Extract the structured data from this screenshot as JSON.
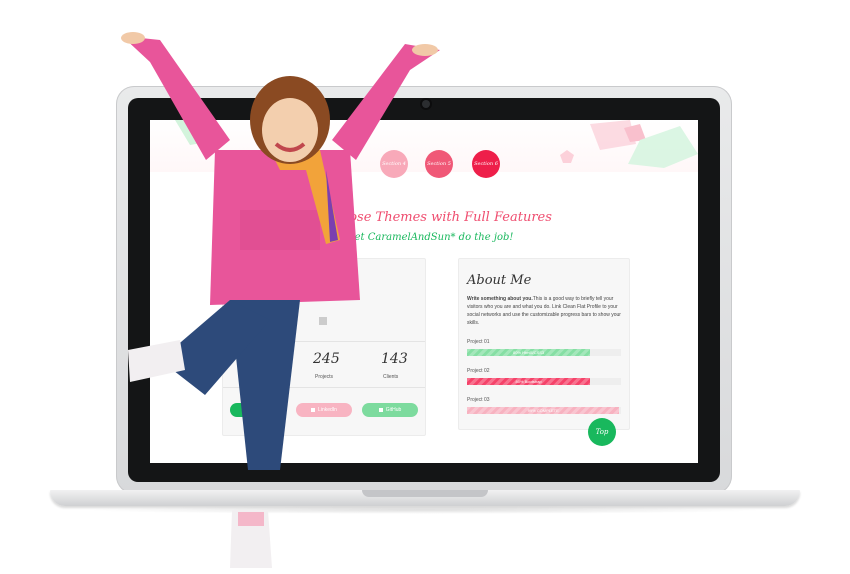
{
  "nav": {
    "items": [
      {
        "label": "Section 4",
        "color": "#f8a9b9"
      },
      {
        "label": "Section 5",
        "color": "#f05877"
      },
      {
        "label": "Section 6",
        "color": "#ee1f4a"
      }
    ]
  },
  "hero": {
    "headline": "purpose Themes with Full Features",
    "subline": "Let CaramelAndSun* do the job!"
  },
  "profile": {
    "stats": [
      {
        "value": "245",
        "label": "Projects"
      },
      {
        "value": "143",
        "label": "Clients"
      }
    ],
    "social": [
      {
        "label": "LinkedIn",
        "color": "#f8b4c2"
      },
      {
        "label": "GitHub",
        "color": "#7ddb9e"
      }
    ],
    "first_social_color": "#19b85d"
  },
  "about": {
    "title": "About Me",
    "lead": "Write something about you.",
    "body": "This is a good way to briefly tell your visitors who you are and what you do. Link Clean Flat Profile to your social networks and use the customizable progress bars to show your skills.",
    "projects": [
      {
        "label": "Project 01",
        "bar_text": "80% Html5/CSS3",
        "percent": 80,
        "color": "#86dfa4"
      },
      {
        "label": "Project 02",
        "bar_text": "80% Bootstrap",
        "percent": 80,
        "color": "#f5436a"
      },
      {
        "label": "Project 03",
        "bar_text": "99% COMPLETE",
        "percent": 99,
        "color": "#f7b2c0"
      }
    ],
    "top_button": "Top"
  },
  "colors": {
    "accent_pink": "#ef4d6f",
    "accent_green": "#19b85d",
    "jacket": "#e8559a",
    "jeans": "#2d4a7a"
  }
}
